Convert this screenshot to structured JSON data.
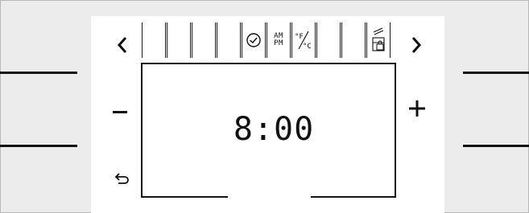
{
  "display": {
    "time": "8:00",
    "ampm_top": "AM",
    "ampm_bottom": "PM"
  },
  "controls": {
    "prev": "‹",
    "next": "›",
    "minus": "−",
    "plus": "+"
  },
  "icons": {
    "clock": "clock-icon",
    "ampm": "am-pm-icon",
    "unit": "fahrenheit-celsius-icon",
    "lock": "child-lock-icon",
    "back": "back-icon"
  }
}
